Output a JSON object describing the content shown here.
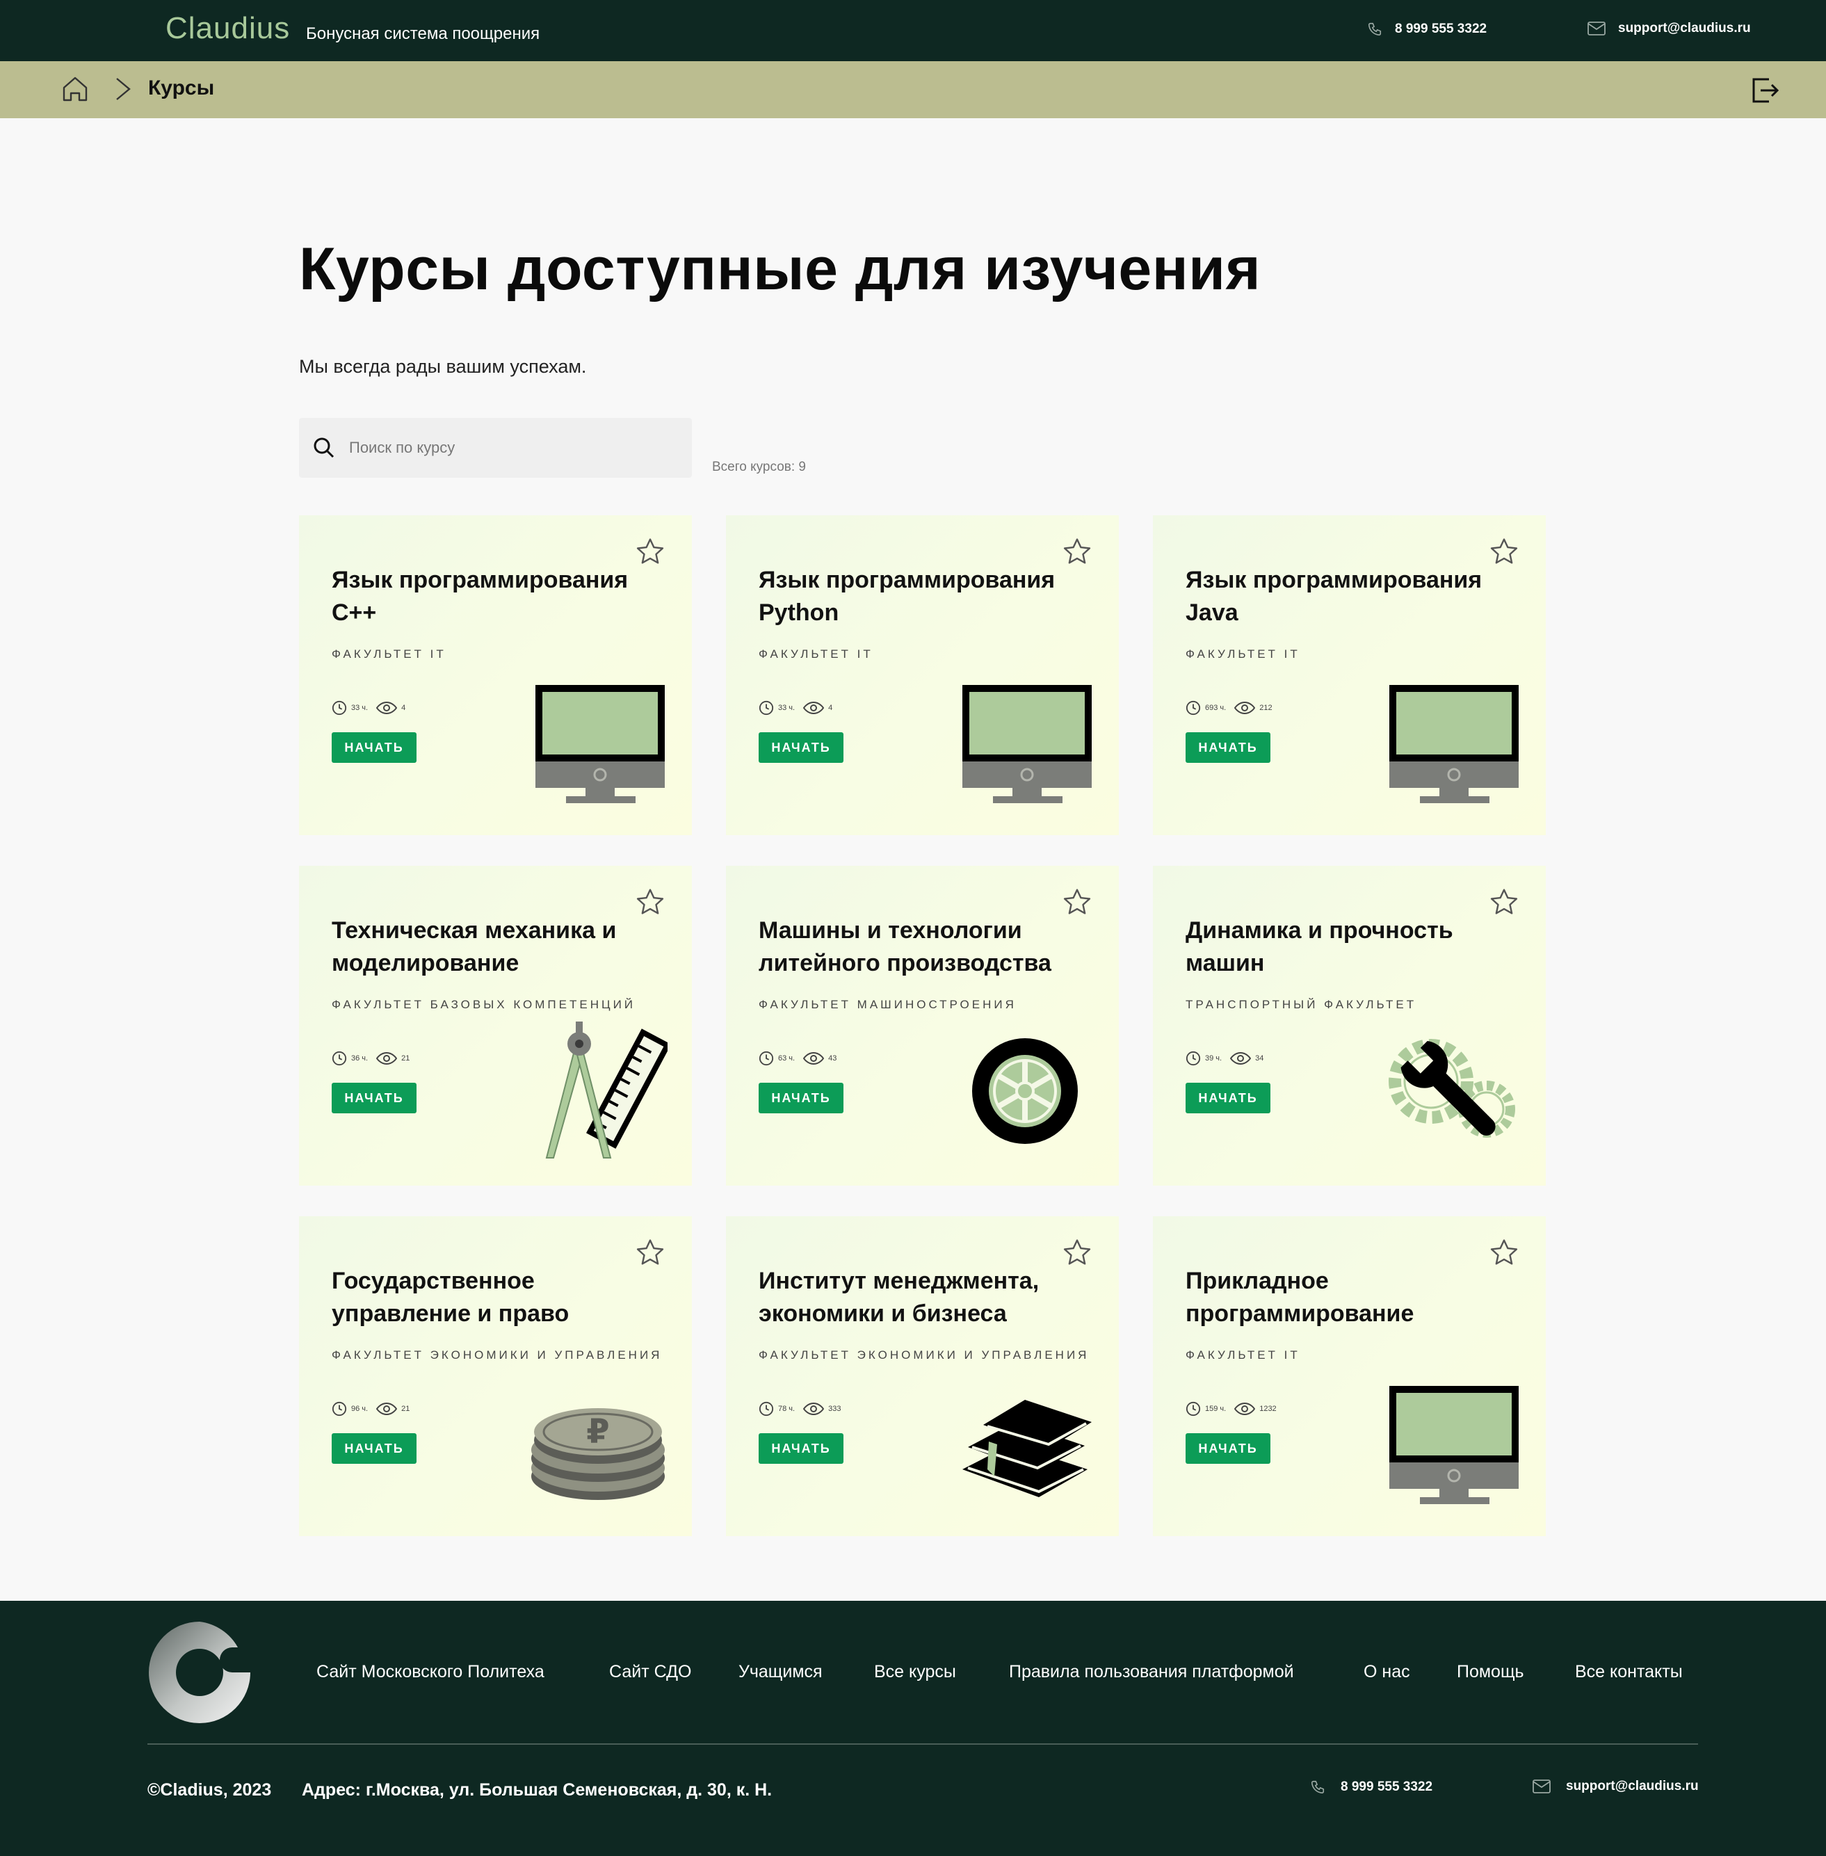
{
  "header": {
    "brand": "Claudius",
    "tagline": "Бонусная система поощрения",
    "phone": "8 999 555 3322",
    "email": "support@claudius.ru"
  },
  "breadcrumb": {
    "current": "Курсы"
  },
  "main": {
    "title": "Курсы доступные для изучения",
    "subtitle": "Мы всегда рады вашим успехам.",
    "search_placeholder": "Поиск по курсу",
    "total_label": "Всего курсов: 9"
  },
  "courses": [
    {
      "title": "Язык программирования С++",
      "faculty": "Факультет IT",
      "hours": "33 ч.",
      "views": "4",
      "button": "НАЧАТЬ",
      "icon": "monitor-icon"
    },
    {
      "title": "Язык программирования Python",
      "faculty": "Факультет IT",
      "hours": "33 ч.",
      "views": "4",
      "button": "НАЧАТЬ",
      "icon": "monitor-icon"
    },
    {
      "title": "Язык программирования Java",
      "faculty": "Факультет IT",
      "hours": "693 ч.",
      "views": "212",
      "button": "НАЧАТЬ",
      "icon": "monitor-icon"
    },
    {
      "title": "Техническая механика и моделирование",
      "faculty": "Факультет базовых компетенций",
      "hours": "36 ч.",
      "views": "21",
      "button": "НАЧАТЬ",
      "icon": "compass-ruler-icon"
    },
    {
      "title": "Машины и технологии литейного производства",
      "faculty": "Факультет машиностроения",
      "hours": "63 ч.",
      "views": "43",
      "button": "НАЧАТЬ",
      "icon": "wheel-icon"
    },
    {
      "title": "Динамика и прочность машин",
      "faculty": "Транспортный факультет",
      "hours": "39 ч.",
      "views": "34",
      "button": "НАЧАТЬ",
      "icon": "gears-wrench-icon"
    },
    {
      "title": "Государственное управление и право",
      "faculty": "Факультет экономики и управления",
      "hours": "96 ч.",
      "views": "21",
      "button": "НАЧАТЬ",
      "icon": "coins-icon"
    },
    {
      "title": "Институт менеджмента, экономики и бизнеса",
      "faculty": "Факультет экономики и управления",
      "hours": "78 ч.",
      "views": "333",
      "button": "НАЧАТЬ",
      "icon": "books-icon"
    },
    {
      "title": "Прикладное программирование",
      "faculty": "Факультет IT",
      "hours": "159 ч.",
      "views": "1232",
      "button": "НАЧАТЬ",
      "icon": "monitor-icon"
    }
  ],
  "footer": {
    "nav": [
      "Сайт Московского Политеха",
      "Сайт СДО",
      "Учащимся",
      "Все курсы",
      "Правила пользования платформой",
      "О нас",
      "Помощь",
      "Все контакты"
    ],
    "copyright": "©Cladius, 2023",
    "address": "Адрес: г.Москва, ул. Большая Семеновская, д. 30, к. Н.",
    "phone": "8 999 555 3322",
    "email": "support@claudius.ru"
  },
  "colors": {
    "header_bg": "#0e2822",
    "breadcrumb_bg": "#bbbd90",
    "brand_green": "#a8c99a",
    "button_green": "#0c9c57",
    "card_bg": "#f6fce4"
  }
}
